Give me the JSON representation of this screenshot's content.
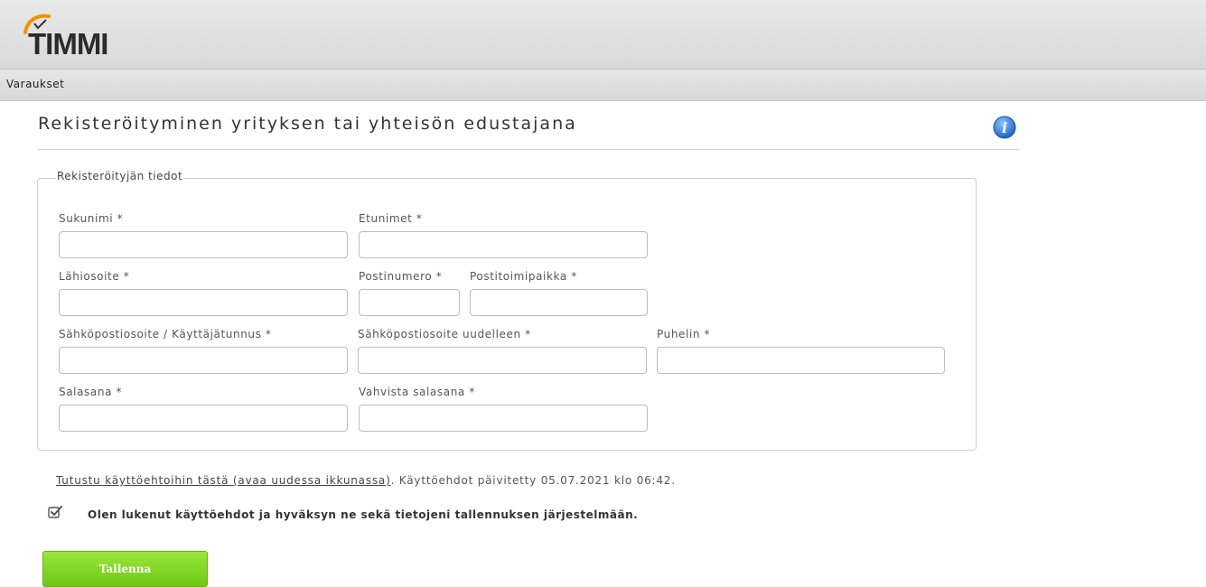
{
  "app": {
    "logo_text": "TIMMI"
  },
  "nav": {
    "items": [
      {
        "label": "Varaukset"
      }
    ]
  },
  "page": {
    "title": "Rekisteröityminen yrityksen tai yhteisön edustajana"
  },
  "form": {
    "legend": "Rekisteröityjän tiedot",
    "fields": {
      "sukunimi": {
        "label": "Sukunimi *",
        "value": ""
      },
      "etunimet": {
        "label": "Etunimet *",
        "value": ""
      },
      "lahiosoite": {
        "label": "Lähiosoite *",
        "value": ""
      },
      "postinumero": {
        "label": "Postinumero *",
        "value": ""
      },
      "postitoimipaikka": {
        "label": "Postitoimipaikka *",
        "value": ""
      },
      "sahkoposti": {
        "label": "Sähköpostiosoite / Käyttäjätunnus *",
        "value": ""
      },
      "sahkoposti_uudelleen": {
        "label": "Sähköpostiosoite uudelleen *",
        "value": ""
      },
      "puhelin": {
        "label": "Puhelin *",
        "value": ""
      },
      "salasana": {
        "label": "Salasana *",
        "value": ""
      },
      "vahvista_salasana": {
        "label": "Vahvista salasana *",
        "value": ""
      }
    }
  },
  "terms": {
    "link_text": "Tutustu käyttöehtoihin tästä (avaa uudessa ikkunassa)",
    "updated_text": ". Käyttöehdot päivitetty 05.07.2021 klo 06:42.",
    "accept_label": "Olen lukenut käyttöehdot ja hyväksyn ne sekä tietojeni tallennuksen järjestelmään.",
    "accepted": true
  },
  "actions": {
    "save_label": "Tallenna"
  },
  "colors": {
    "logo_orange": "#f39200",
    "info_blue": "#2f7fd1",
    "save_green": "#7fd527"
  },
  "icons": {
    "info": "info-icon",
    "checkbox": "checkbox-checked-icon"
  }
}
